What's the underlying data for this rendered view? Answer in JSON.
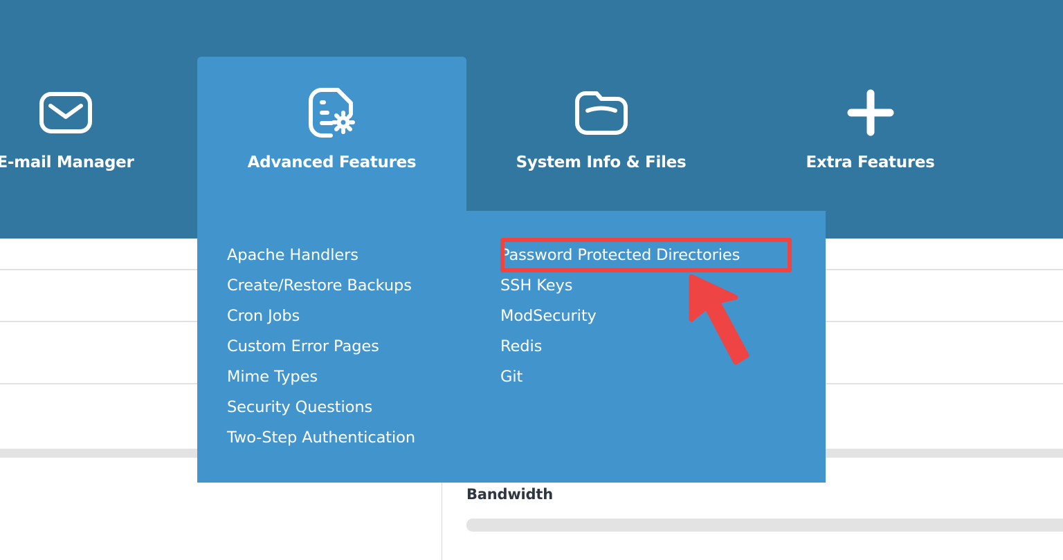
{
  "topnav": {
    "background_color": "#32779f",
    "active_color": "#4295cc",
    "items": [
      {
        "id": "email-manager",
        "label": "E-mail Manager",
        "icon": "envelope-icon",
        "active": false
      },
      {
        "id": "advanced-features",
        "label": "Advanced Features",
        "icon": "document-gear-icon",
        "active": true
      },
      {
        "id": "system-info-files",
        "label": "System Info & Files",
        "icon": "folder-icon",
        "active": false
      },
      {
        "id": "extra-features",
        "label": "Extra Features",
        "icon": "plus-icon",
        "active": false
      }
    ]
  },
  "dropdown": {
    "background_color": "#4295cc",
    "left_column": [
      {
        "label": "Apache Handlers"
      },
      {
        "label": "Create/Restore Backups"
      },
      {
        "label": "Cron Jobs"
      },
      {
        "label": "Custom Error Pages"
      },
      {
        "label": "Mime Types"
      },
      {
        "label": "Security Questions"
      },
      {
        "label": "Two-Step Authentication"
      }
    ],
    "right_column": [
      {
        "label": "Password Protected Directories",
        "highlighted": true
      },
      {
        "label": "SSH Keys"
      },
      {
        "label": "ModSecurity"
      },
      {
        "label": "Redis"
      },
      {
        "label": "Git"
      }
    ]
  },
  "annotation": {
    "highlight_color": "#ef4444",
    "target_label": "Password Protected Directories",
    "arrow": "pointer-arrow-up-left"
  },
  "background": {
    "bandwidth_title": "Bandwidth",
    "divider_color": "#e2e2e2",
    "band_color": "#e3e3e3",
    "bar_color": "#e3e3e3"
  }
}
